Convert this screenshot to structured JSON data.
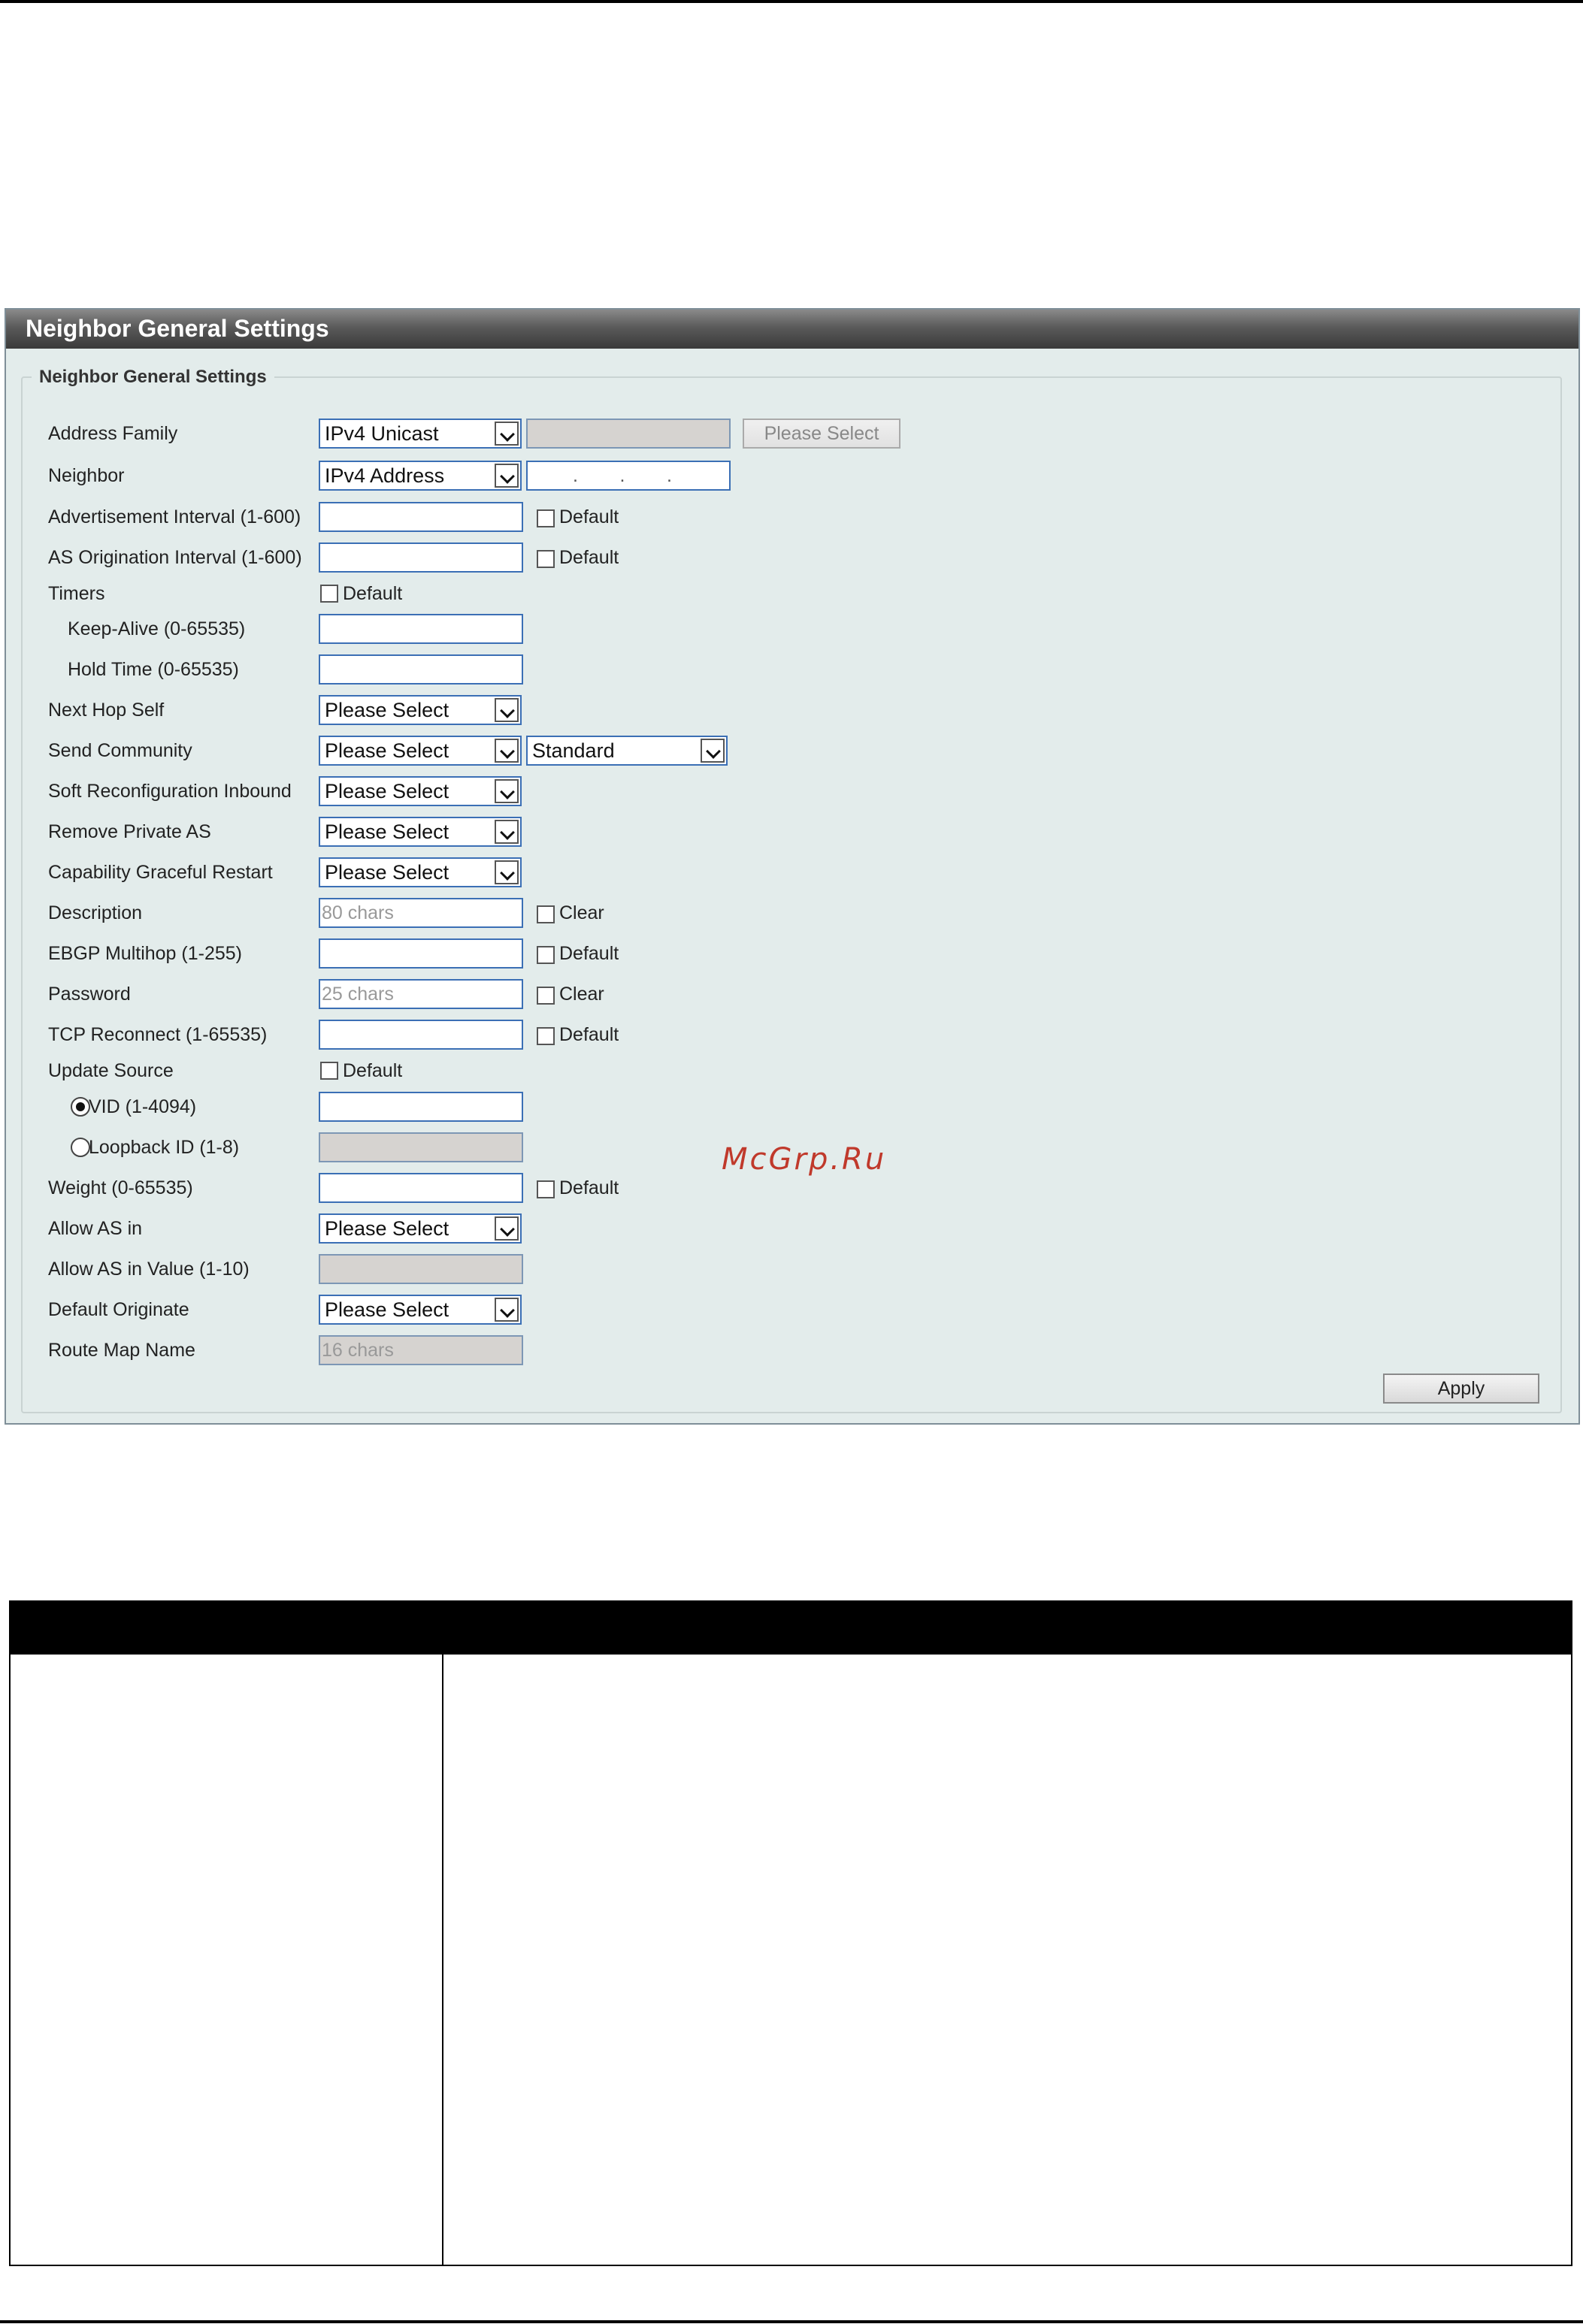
{
  "panel": {
    "title": "Neighbor General Settings",
    "legend": "Neighbor General Settings"
  },
  "form": {
    "address_family": {
      "label": "Address Family",
      "value": "IPv4 Unicast",
      "extra_button": "Please Select"
    },
    "neighbor": {
      "label": "Neighbor",
      "value": "IPv4 Address",
      "ip_placeholder": ".        .        ."
    },
    "advertisement_interval": {
      "label": "Advertisement Interval (1-600)",
      "checkbox": "Default"
    },
    "as_origination_interval": {
      "label": "AS Origination Interval (1-600)",
      "checkbox": "Default"
    },
    "timers": {
      "label": "Timers",
      "checkbox": "Default"
    },
    "keep_alive": {
      "label": "Keep-Alive (0-65535)"
    },
    "hold_time": {
      "label": "Hold Time (0-65535)"
    },
    "next_hop_self": {
      "label": "Next Hop Self",
      "value": "Please Select"
    },
    "send_community": {
      "label": "Send Community",
      "value": "Please Select",
      "type_value": "Standard"
    },
    "soft_reconfiguration_inbound": {
      "label": "Soft Reconfiguration Inbound",
      "value": "Please Select"
    },
    "remove_private_as": {
      "label": "Remove Private AS",
      "value": "Please Select"
    },
    "capability_graceful_restart": {
      "label": "Capability Graceful Restart",
      "value": "Please Select"
    },
    "description": {
      "label": "Description",
      "placeholder": "80 chars",
      "checkbox": "Clear"
    },
    "ebgp_multihop": {
      "label": "EBGP Multihop (1-255)",
      "checkbox": "Default"
    },
    "password": {
      "label": "Password",
      "placeholder": "25 chars",
      "checkbox": "Clear"
    },
    "tcp_reconnect": {
      "label": "TCP Reconnect (1-65535)",
      "checkbox": "Default"
    },
    "update_source": {
      "label": "Update Source",
      "checkbox": "Default"
    },
    "vid": {
      "label": "VID (1-4094)",
      "selected": true
    },
    "loopback_id": {
      "label": "Loopback ID (1-8)",
      "selected": false
    },
    "weight": {
      "label": "Weight (0-65535)",
      "checkbox": "Default"
    },
    "allow_as_in": {
      "label": "Allow AS in",
      "value": "Please Select"
    },
    "allow_as_in_value": {
      "label": "Allow AS in Value (1-10)"
    },
    "default_originate": {
      "label": "Default Originate",
      "value": "Please Select"
    },
    "route_map_name": {
      "label": "Route Map Name",
      "placeholder": "16 chars"
    },
    "apply_label": "Apply"
  },
  "watermark": "McGrp.Ru",
  "colors": {
    "title_bar": "#4a4a4a",
    "panel_bg": "#e3eceb",
    "input_border": "#3b6fb5",
    "watermark": "#c0392b"
  }
}
